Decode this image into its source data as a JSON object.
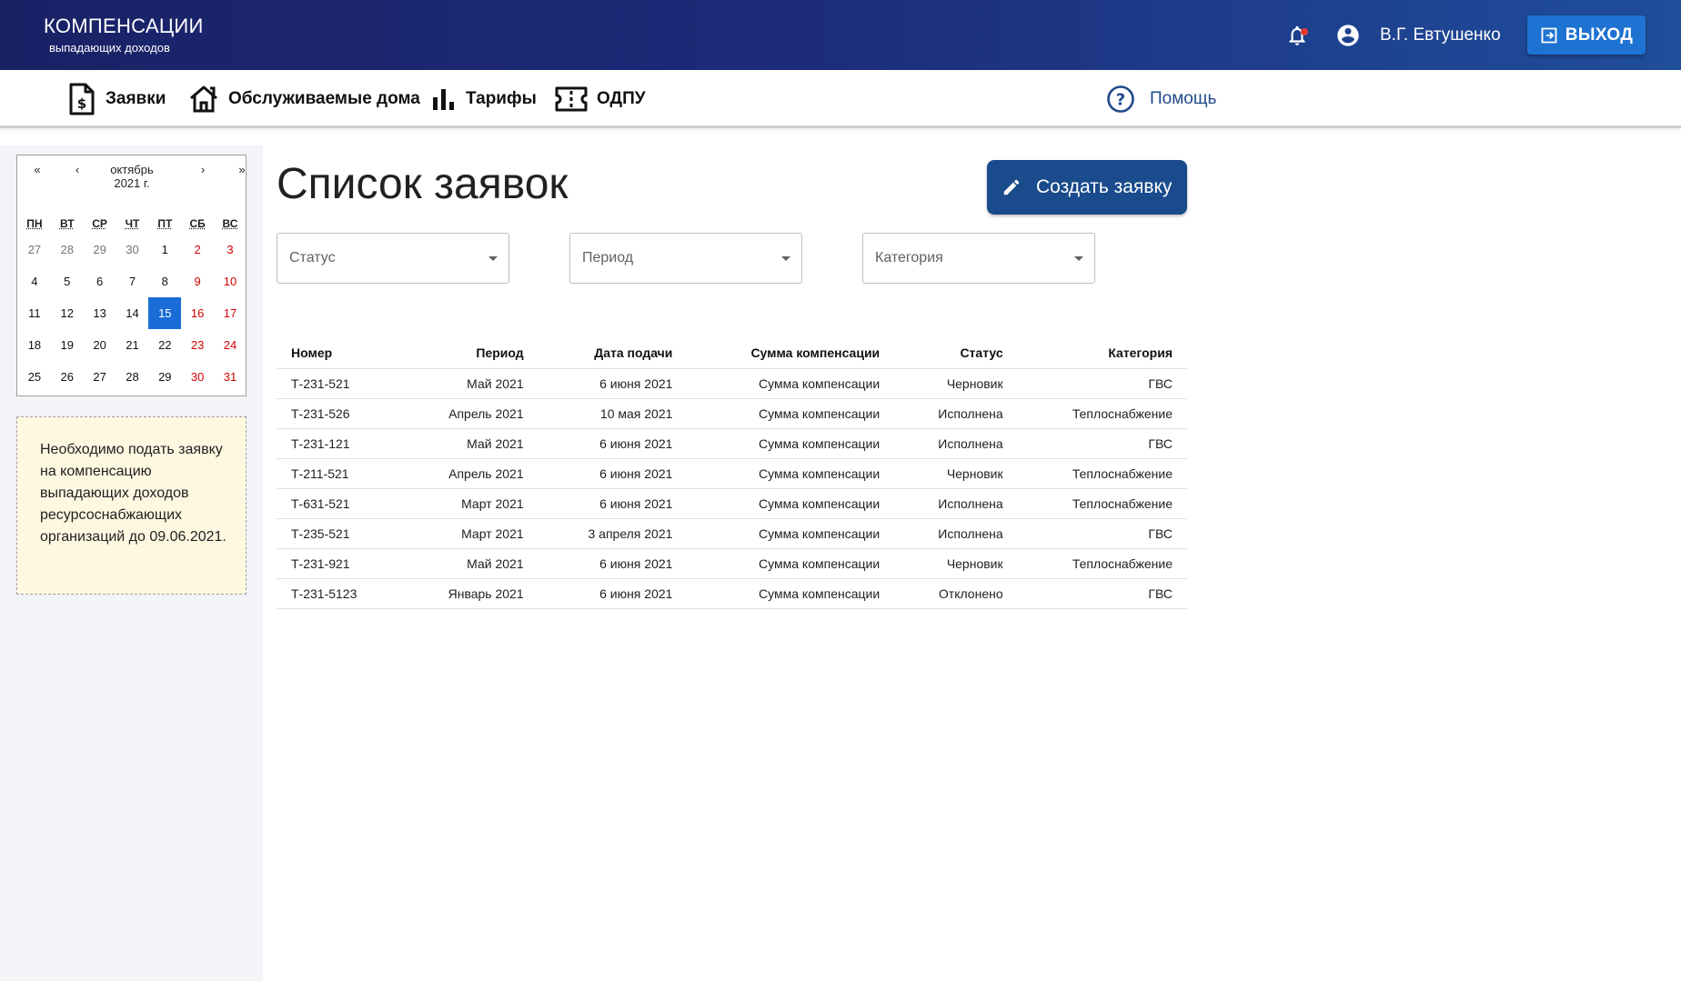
{
  "header": {
    "brand_title": "КОМПЕНСАЦИИ",
    "brand_subtitle": "выпадающих доходов",
    "user_name": "В.Г. Евтушенко",
    "logout_label": "ВЫХОД",
    "notification_color": "#e53935"
  },
  "nav": {
    "items": [
      {
        "label": "Заявки",
        "icon": "dollar-document-icon"
      },
      {
        "label": "Обслуживаемые дома",
        "icon": "house-icon"
      },
      {
        "label": "Тарифы",
        "icon": "bar-chart-icon"
      },
      {
        "label": "ОДПУ",
        "icon": "ticket-icon"
      }
    ],
    "help_label": "Помощь"
  },
  "calendar": {
    "month": "октябрь",
    "year": "2021 г.",
    "prev_year": "«",
    "prev_month": "‹",
    "next_month": "›",
    "next_year": "»",
    "weekdays": [
      "ПН",
      "ВТ",
      "СР",
      "ЧТ",
      "ПТ",
      "СБ",
      "ВС"
    ],
    "weeks": [
      [
        "27",
        "28",
        "29",
        "30",
        "1",
        "2",
        "3"
      ],
      [
        "4",
        "5",
        "6",
        "7",
        "8",
        "9",
        "10"
      ],
      [
        "11",
        "12",
        "13",
        "14",
        "15",
        "16",
        "17"
      ],
      [
        "18",
        "19",
        "20",
        "21",
        "22",
        "23",
        "24"
      ],
      [
        "25",
        "26",
        "27",
        "28",
        "29",
        "30",
        "31"
      ]
    ],
    "muted_days": [
      "27",
      "28",
      "29",
      "30"
    ],
    "selected_day": "15",
    "weekend_color": "#d10000",
    "selected_color": "#1a6dd6"
  },
  "notice": {
    "text": "Необходимо подать заявку на компенсацию выпадающих доходов ресурсоснабжающих организаций до 09.06.2021."
  },
  "main": {
    "title": "Список заявок",
    "create_button_label": "Создать заявку",
    "filters": [
      {
        "placeholder": "Статус"
      },
      {
        "placeholder": "Период"
      },
      {
        "placeholder": "Категория"
      }
    ]
  },
  "table": {
    "columns": [
      "Номер",
      "Период",
      "Дата подачи",
      "Сумма компенсации",
      "Статус",
      "Категория"
    ],
    "rows": [
      [
        "Т-231-521",
        "Май 2021",
        "6 июня 2021",
        "Сумма компенсации",
        "Черновик",
        "ГВС"
      ],
      [
        "Т-231-526",
        "Апрель 2021",
        "10 мая 2021",
        "Сумма компенсации",
        "Исполнена",
        "Теплоснабжение"
      ],
      [
        "Т-231-121",
        "Май 2021",
        "6 июня 2021",
        "Сумма компенсации",
        "Исполнена",
        "ГВС"
      ],
      [
        "Т-211-521",
        "Апрель 2021",
        "6 июня 2021",
        "Сумма компенсации",
        "Черновик",
        "Теплоснабжение"
      ],
      [
        "Т-631-521",
        "Март 2021",
        "6 июня 2021",
        "Сумма компенсации",
        "Исполнена",
        "Теплоснабжение"
      ],
      [
        "Т-235-521",
        "Март 2021",
        "3 апреля 2021",
        "Сумма компенсации",
        "Исполнена",
        "ГВС"
      ],
      [
        "Т-231-921",
        "Май 2021",
        "6 июня 2021",
        "Сумма компенсации",
        "Черновик",
        "Теплоснабжение"
      ],
      [
        "Т-231-5123",
        "Январь 2021",
        "6 июня 2021",
        "Сумма компенсации",
        "Отклонено",
        "ГВС"
      ]
    ]
  }
}
